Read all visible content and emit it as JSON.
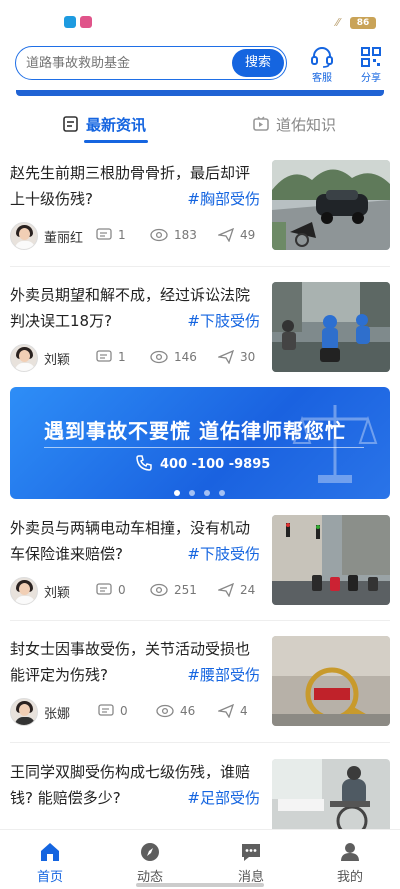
{
  "status_bar": {
    "battery": "86"
  },
  "header": {
    "search_placeholder": "道路事故救助基金",
    "search_button": "搜索",
    "service_label": "客服",
    "share_label": "分享"
  },
  "tabs": [
    {
      "label": "最新资讯",
      "active": true
    },
    {
      "label": "道佑知识",
      "active": false
    }
  ],
  "articles": [
    {
      "title": "赵先生前期三根肋骨骨折，最后却评上十级伤残?",
      "tag": "#胸部受伤",
      "author": "董丽红",
      "comments": "1",
      "views": "183",
      "shares": "49"
    },
    {
      "title": "外卖员期望和解不成，经过诉讼法院判决误工18万?",
      "tag": "#下肢受伤",
      "author": "刘颖",
      "comments": "1",
      "views": "146",
      "shares": "30"
    },
    {
      "title": "外卖员与两辆电动车相撞，没有机动车保险谁来赔偿?",
      "tag": "#下肢受伤",
      "author": "刘颖",
      "comments": "0",
      "views": "251",
      "shares": "24"
    },
    {
      "title": "封女士因事故受伤，关节活动受损也能评定为伤残?",
      "tag": "#腰部受伤",
      "author": "张娜",
      "comments": "0",
      "views": "46",
      "shares": "4"
    },
    {
      "title": "王同学双脚受伤构成七级伤残，谁赔钱? 能赔偿多少?",
      "tag": "#足部受伤",
      "author": "",
      "comments": "",
      "views": "",
      "shares": ""
    }
  ],
  "ad_banner": {
    "title": "遇到事故不要慌   道佑律师帮您忙",
    "phone": "400 -100 -9895",
    "dots": 4,
    "active_dot": 0
  },
  "tabbar": [
    {
      "label": "首页",
      "icon": "home-icon",
      "active": true
    },
    {
      "label": "动态",
      "icon": "compass-icon",
      "active": false
    },
    {
      "label": "消息",
      "icon": "message-icon",
      "active": false
    },
    {
      "label": "我的",
      "icon": "user-icon",
      "active": false
    }
  ],
  "colors": {
    "accent": "#1565e0",
    "tag": "#1565e0"
  }
}
